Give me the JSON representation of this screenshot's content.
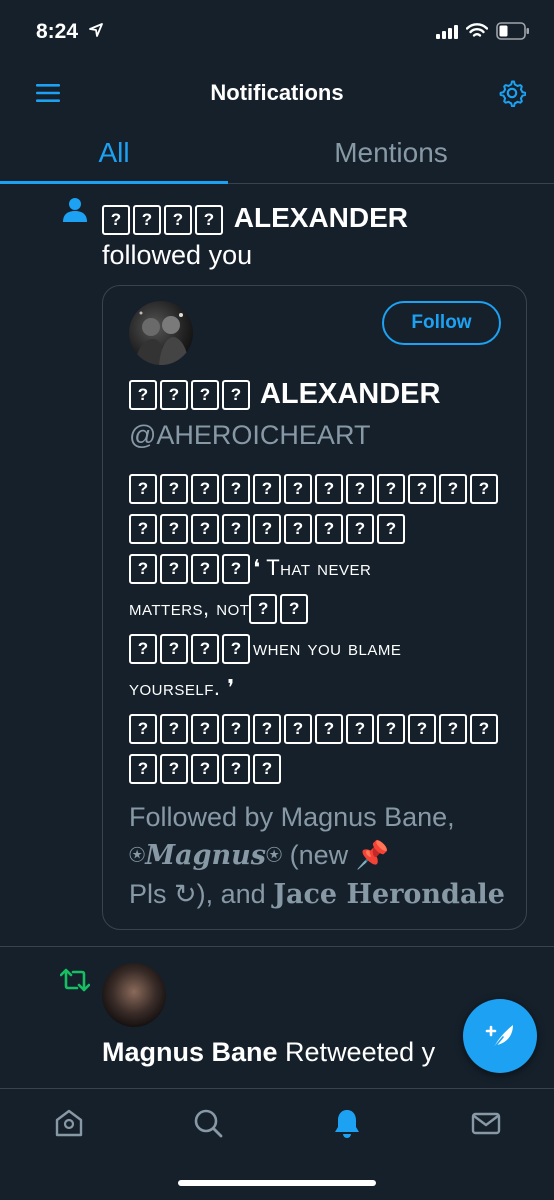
{
  "status_bar": {
    "time": "8:24"
  },
  "header": {
    "title": "Notifications"
  },
  "tabs": [
    {
      "label": "All",
      "selected": true
    },
    {
      "label": "Mentions",
      "selected": false
    }
  ],
  "follow_notification": {
    "name_suffix": "ALEXANDER",
    "action": "followed you",
    "card": {
      "follow_label": "Follow",
      "name_suffix": "ALEXANDER",
      "handle": "@AHEROICHEART",
      "bio": {
        "line3_text": "That never",
        "line4_text": "matters, not",
        "line5_text": "when you blame",
        "line6_text": "yourself."
      },
      "followed_by_prefix": "Followed by Magnus Bane,",
      "followed_by_script": "Magnus",
      "followed_by_mid": "(new",
      "followed_by_pls": "Pls",
      "followed_by_and": "), and",
      "followed_by_last": "Jace Herondale"
    }
  },
  "retweet_notification": {
    "name": "Magnus Bane",
    "action": "Retweeted y"
  },
  "colors": {
    "background": "#15202b",
    "accent": "#1da1f2",
    "muted": "#8899a6",
    "retweet_green": "#17bf63"
  }
}
